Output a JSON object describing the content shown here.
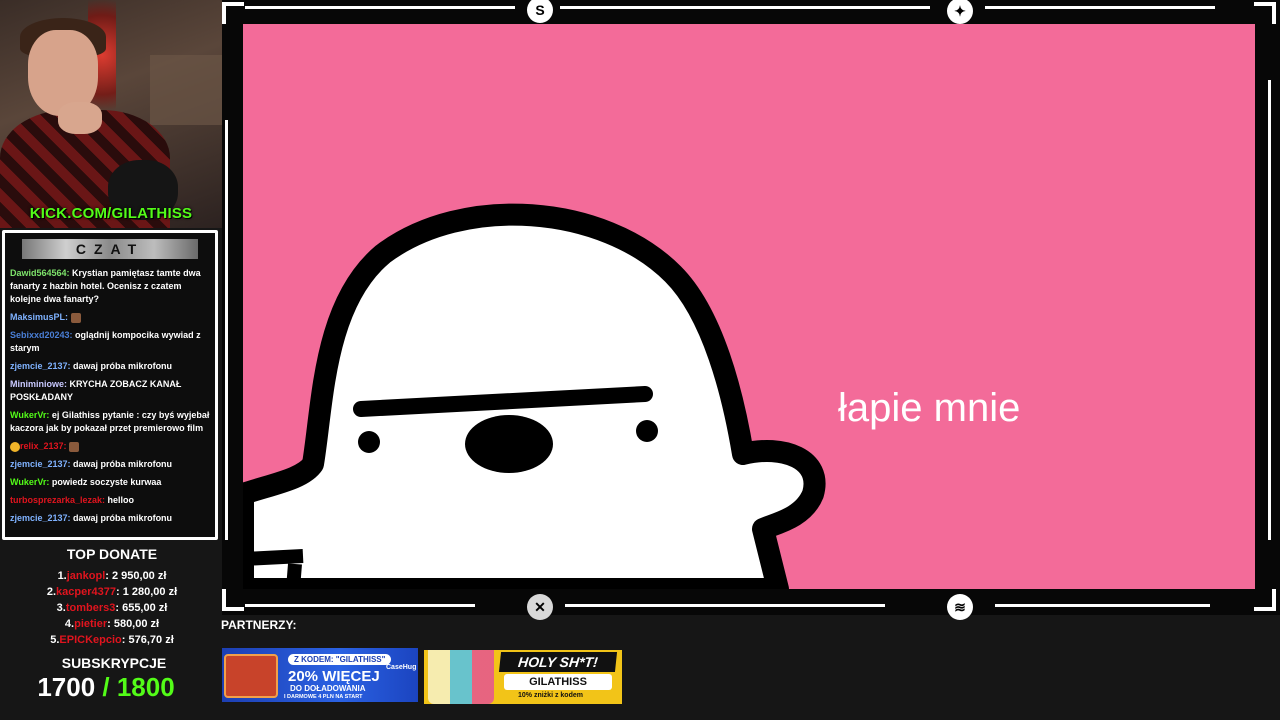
{
  "webcam": {
    "kick_url": "KICK.COM/GILATHISS"
  },
  "chat": {
    "title": "CZAT",
    "messages": [
      {
        "user": "Dawid564564",
        "user_color": "#7ee36b",
        "text": " Krystian pamiętasz tamte dwa fanarty z hazbin hotel. Ocenisz z czatem kolejne dwa fanarty?"
      },
      {
        "user": "MaksimusPL",
        "user_color": "#7fb2ff",
        "text": " ",
        "emote": true
      },
      {
        "user": "Sebixxd20243",
        "user_color": "#4a7fd6",
        "text": " oglądnij kompocika wywiad z starym"
      },
      {
        "user": "zjemcie_2137",
        "user_color": "#7fb2ff",
        "text": " dawaj próba mikrofonu"
      },
      {
        "user": "Miniminiowe",
        "user_color": "#c9c9ff",
        "text": " KRYCHA ZOBACZ KANAŁ POSKŁADANY"
      },
      {
        "user": "WukerVr",
        "user_color": "#53fc18",
        "text": " ej Gilathiss pytanie : czy byś wyjebał kaczora jak by pokazał przet premierowo film"
      },
      {
        "user": "relix_2137",
        "user_color": "#e0141e",
        "text": " ",
        "emote": true,
        "prefix_emote": true
      },
      {
        "user": "zjemcie_2137",
        "user_color": "#7fb2ff",
        "text": " dawaj próba mikrofonu"
      },
      {
        "user": "WukerVr",
        "user_color": "#53fc18",
        "text": " powiedz soczyste kurwaa"
      },
      {
        "user": "turbosprezarka_lezak",
        "user_color": "#e0141e",
        "text": " helloo"
      },
      {
        "user": "zjemcie_2137",
        "user_color": "#7fb2ff",
        "text": " dawaj próba mikrofonu"
      }
    ]
  },
  "donations": {
    "title": "TOP DONATE",
    "items": [
      {
        "rank": "1.",
        "name": "jankopl",
        "amount": ": 2 950,00 zł"
      },
      {
        "rank": "2.",
        "name": "kacper4377",
        "amount": ": 1 280,00 zł"
      },
      {
        "rank": "3.",
        "name": "tombers3",
        "amount": ": 655,00 zł"
      },
      {
        "rank": "4.",
        "name": "pietier",
        "amount": ": 580,00 zł"
      },
      {
        "rank": "5.",
        "name": "EPICKepcio",
        "amount": ": 576,70 zł"
      }
    ]
  },
  "subs": {
    "title": "SUBSKRYPCJE",
    "current": "1700",
    "goal": "/ 1800"
  },
  "video": {
    "caption": "łapie mnie",
    "bg_color": "#f36b99"
  },
  "partners": {
    "title": "PARTNERZY:",
    "ad1": {
      "code": "Z KODEM: \"GILATHISS\"",
      "headline": "20% WIĘCEJ",
      "line2": "DO DOŁADOWANIA",
      "line3": "I DARMOWE 4 PLN NA START",
      "brand": "CaseHug"
    },
    "ad2": {
      "logo": "HOLY SH*T!",
      "code": "GILATHISS",
      "discount": "10% zniżki z kodem"
    }
  }
}
